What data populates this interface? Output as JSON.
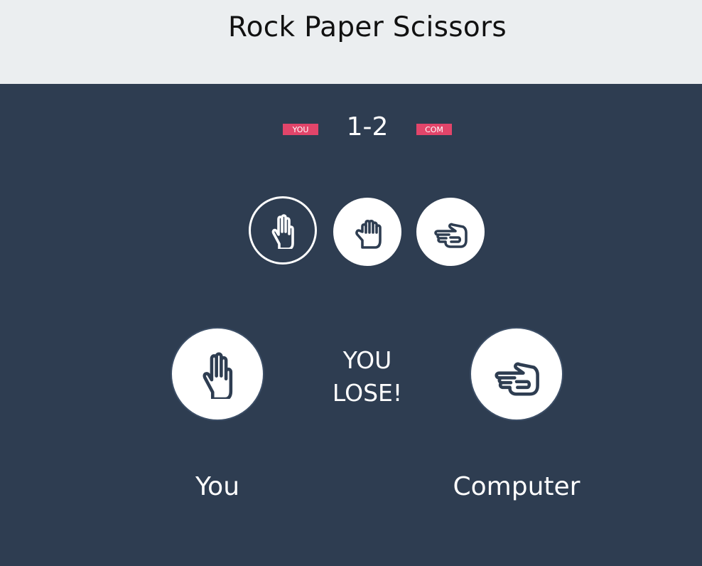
{
  "header": {
    "title": "Rock Paper Scissors"
  },
  "scoreboard": {
    "you_badge": "YOU",
    "score": "1-2",
    "com_badge": "COM"
  },
  "choices": [
    {
      "name": "paper",
      "icon": "paper-hand-icon",
      "selected": true
    },
    {
      "name": "rock",
      "icon": "rock-hand-icon",
      "selected": false
    },
    {
      "name": "scissors",
      "icon": "scissors-hand-icon",
      "selected": false
    }
  ],
  "result": {
    "line1": "YOU",
    "line2": "LOSE!"
  },
  "player": {
    "label": "You",
    "choice_icon": "paper-hand-icon"
  },
  "computer": {
    "label": "Computer",
    "choice_icon": "scissors-hand-icon"
  },
  "colors": {
    "background": "#2e3d51",
    "header": "#ebeef0",
    "badge": "#e2456a",
    "icon": "#2e3d51"
  }
}
